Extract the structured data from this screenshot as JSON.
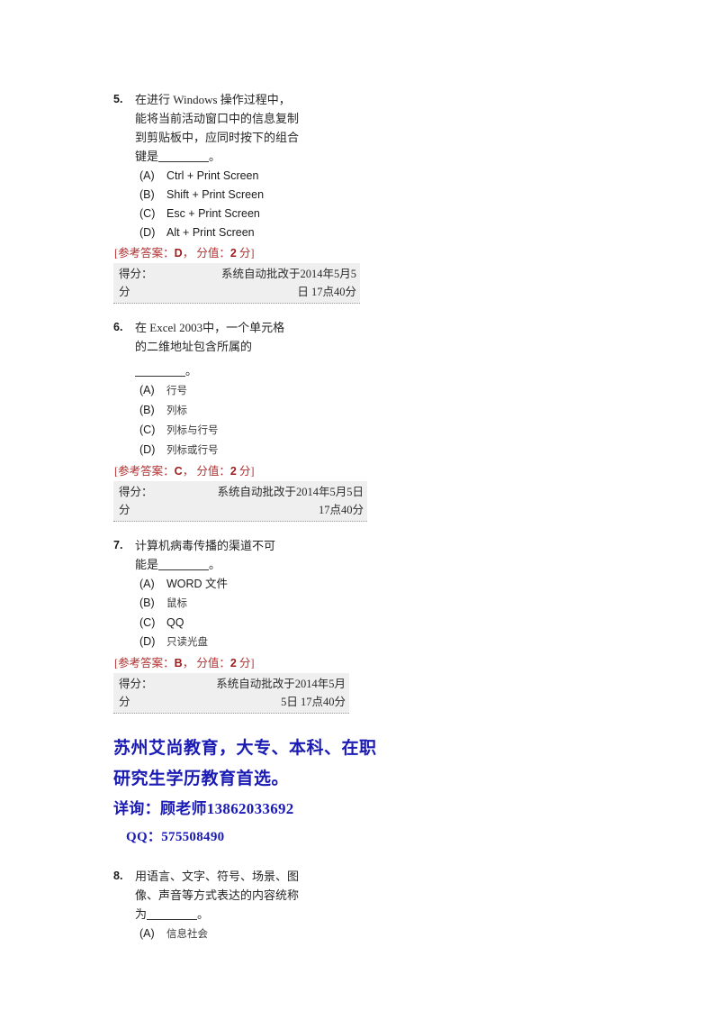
{
  "document": {
    "type": "exam-answer-sheet",
    "language": "zh-CN",
    "colors": {
      "answer_red": "#b03030",
      "answer_letter_red": "#9e1b1b",
      "ad_blue": "#1a1ab4",
      "score_box_bg": "#efefef",
      "text": "#252525"
    }
  },
  "questions": [
    {
      "number": "5.",
      "stem_lines": [
        "在进行 Windows 操作过程中，",
        "能将当前活动窗口中的信息复制",
        "到剪贴板中，应同时按下的组合",
        "键是"
      ],
      "stem_tail": "。",
      "options": [
        {
          "key": "(A)",
          "text": "Ctrl + Print Screen"
        },
        {
          "key": "(B)",
          "text": "Shift + Print Screen"
        },
        {
          "key": "(C)",
          "text": "Esc + Print Screen"
        },
        {
          "key": "(D)",
          "text": "Alt + Print Screen"
        }
      ],
      "answer": {
        "prefix": "[参考答案：",
        "letter": "D",
        "middle": "， 分值：",
        "points": "2",
        "suffix": " 分]"
      },
      "score_box": {
        "row1_label": "得分：",
        "row1_value": "系统自动批改于2014年5月5",
        "row2_label": "分",
        "row2_value": "日 17点40分"
      }
    },
    {
      "number": "6.",
      "stem_lines": [
        "在 Excel    2003中，一个单元格",
        "的二维地址包含所属的"
      ],
      "stem_tail": "。",
      "options": [
        {
          "key": "(A)",
          "text": "行号"
        },
        {
          "key": "(B)",
          "text": "列标"
        },
        {
          "key": "(C)",
          "text": "列标与行号"
        },
        {
          "key": "(D)",
          "text": "列标或行号"
        }
      ],
      "answer": {
        "prefix": "[参考答案：",
        "letter": "C",
        "middle": "， 分值：",
        "points": "2",
        "suffix": " 分]"
      },
      "score_box": {
        "row1_label": "得分：",
        "row1_value": "系统自动批改于2014年5月5日",
        "row2_label": "分",
        "row2_value": "17点40分"
      }
    },
    {
      "number": "7.",
      "stem_lines": [
        "计算机病毒传播的渠道不可",
        "能是"
      ],
      "stem_tail": "。",
      "options": [
        {
          "key": "(A)",
          "text": "WORD 文件"
        },
        {
          "key": "(B)",
          "text": "鼠标"
        },
        {
          "key": "(C)",
          "text": "QQ"
        },
        {
          "key": "(D)",
          "text": "只读光盘"
        }
      ],
      "answer": {
        "prefix": "[参考答案：",
        "letter": "B",
        "middle": "， 分值：",
        "points": "2",
        "suffix": " 分]"
      },
      "score_box": {
        "row1_label": "得分：",
        "row1_value": "系统自动批改于2014年5月",
        "row2_label": "分",
        "row2_value": "5日 17点40分"
      }
    },
    {
      "number": "8.",
      "stem_lines": [
        "用语言、文字、符号、场景、图",
        "像、声音等方式表达的内容统称",
        "为"
      ],
      "stem_tail": "。",
      "options": [
        {
          "key": "(A)",
          "text": "信息社会"
        }
      ]
    }
  ],
  "advertisement": {
    "line1": "苏州艾尚教育，大专、本科、在职",
    "line2": "研究生学历教育首选。",
    "line3": "详询：顾老师13862033692",
    "line4": "QQ：575508490"
  }
}
